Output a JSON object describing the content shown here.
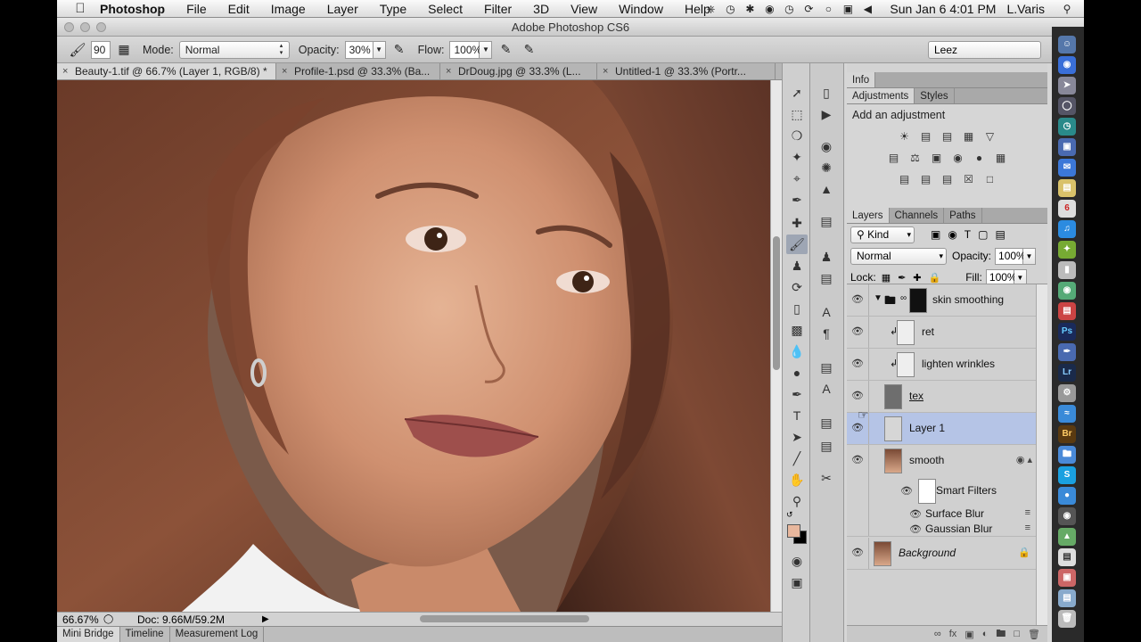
{
  "menubar": {
    "app": "Photoshop",
    "items": [
      "File",
      "Edit",
      "Image",
      "Layer",
      "Type",
      "Select",
      "Filter",
      "3D",
      "View",
      "Window",
      "Help"
    ],
    "clock": "Sun Jan 6  4:01 PM",
    "user": "L.Varis"
  },
  "window": {
    "title": "Adobe Photoshop CS6"
  },
  "options": {
    "brush_size": "90",
    "mode_label": "Mode:",
    "mode_value": "Normal",
    "opacity_label": "Opacity:",
    "opacity_value": "30%",
    "flow_label": "Flow:",
    "flow_value": "100%",
    "workspace": "Leez"
  },
  "doc_tabs": [
    "Beauty-1.tif @ 66.7% (Layer 1, RGB/8) *",
    "Profile-1.psd @ 33.3% (Ba...",
    "DrDoug.jpg @ 33.3% (L...",
    "Untitled-1 @ 33.3% (Portr..."
  ],
  "status": {
    "zoom": "66.67%",
    "doc": "Doc: 9.66M/59.2M"
  },
  "bottom_tabs": [
    "Mini Bridge",
    "Timeline",
    "Measurement Log"
  ],
  "panels": {
    "info_tab": "Info",
    "adj_tabs": [
      "Adjustments",
      "Styles"
    ],
    "adj_title": "Add an adjustment",
    "layer_tabs": [
      "Layers",
      "Channels",
      "Paths"
    ],
    "kind": "Kind",
    "blend": "Normal",
    "opacity_label": "Opacity:",
    "opacity": "100%",
    "lock_label": "Lock:",
    "fill_label": "Fill:",
    "fill": "100%"
  },
  "layers": {
    "group": "skin smoothing",
    "ret": "ret",
    "lighten": "lighten wrinkles",
    "tex": "tex",
    "layer1": "Layer 1",
    "smooth": "smooth",
    "smart_filters": "Smart Filters",
    "surface_blur": "Surface Blur",
    "gaussian_blur": "Gaussian Blur",
    "background": "Background"
  },
  "colors": {
    "foreground": "#e8b79d",
    "background": "#000000",
    "selection": "#b5c4e6"
  },
  "dock_icons": [
    "Ps",
    "Lr",
    "Br"
  ]
}
